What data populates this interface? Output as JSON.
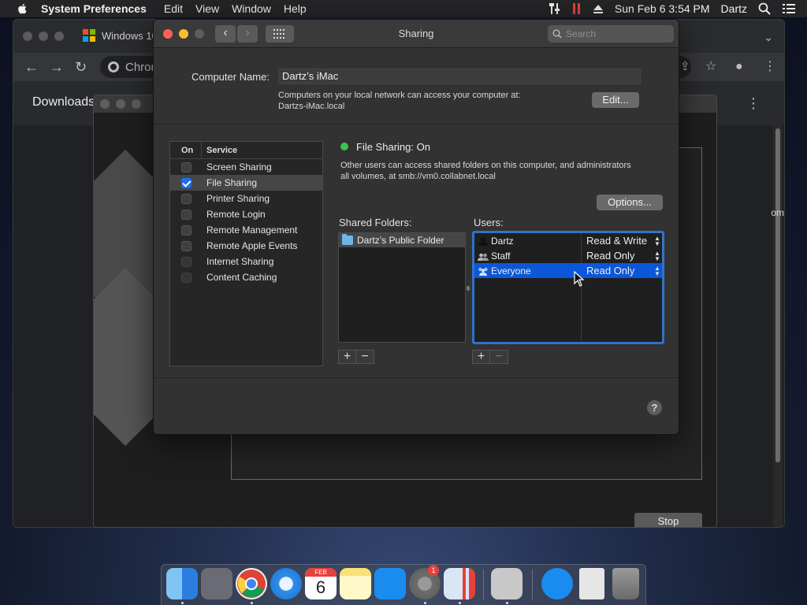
{
  "menubar": {
    "app_name": "System Preferences",
    "menus": [
      "Edit",
      "View",
      "Window",
      "Help"
    ],
    "clock": "Sun Feb 6  3:54 PM",
    "user": "Dartz"
  },
  "chrome": {
    "tab_title": "Windows 10",
    "omnibox_text": "Chrom",
    "page_title": "Downloads",
    "side_text": "om"
  },
  "vm": {
    "stop_label": "Stop"
  },
  "window": {
    "title": "Sharing",
    "search_placeholder": "Search",
    "computer_name_label": "Computer Name:",
    "computer_name_value": "Dartz’s iMac",
    "network_note_line1": "Computers on your local network can access your computer at:",
    "network_note_line2": "Dartzs-iMac.local",
    "edit_label": "Edit...",
    "services_header_on": "On",
    "services_header_service": "Service",
    "services": [
      {
        "label": "Screen Sharing",
        "checked": false
      },
      {
        "label": "File Sharing",
        "checked": true
      },
      {
        "label": "Printer Sharing",
        "checked": false
      },
      {
        "label": "Remote Login",
        "checked": false
      },
      {
        "label": "Remote Management",
        "checked": false
      },
      {
        "label": "Remote Apple Events",
        "checked": false
      },
      {
        "label": "Internet Sharing",
        "checked": false
      },
      {
        "label": "Content Caching",
        "checked": false
      }
    ],
    "status_title": "File Sharing: On",
    "status_desc_line1": "Other users can access shared folders on this computer, and administrators",
    "status_desc_line2": "all volumes, at smb://vm0.collabnet.local",
    "options_label": "Options...",
    "shared_folders_label": "Shared Folders:",
    "users_label": "Users:",
    "shared_folders": [
      "Dartz’s Public Folder"
    ],
    "users": [
      {
        "name": "Dartz",
        "permission": "Read & Write"
      },
      {
        "name": "Staff",
        "permission": "Read Only"
      },
      {
        "name": "Everyone",
        "permission": "Read Only"
      }
    ],
    "plus_symbol": "+",
    "minus_symbol": "−",
    "help_symbol": "?"
  },
  "dock": {
    "calendar_month": "FEB",
    "calendar_day": "6",
    "badge_count": "1"
  },
  "colors": {
    "selection_blue": "#0c57d8",
    "status_green": "#3bc44b",
    "close_red": "#ff5f57",
    "minimize_yellow": "#febc2e"
  }
}
